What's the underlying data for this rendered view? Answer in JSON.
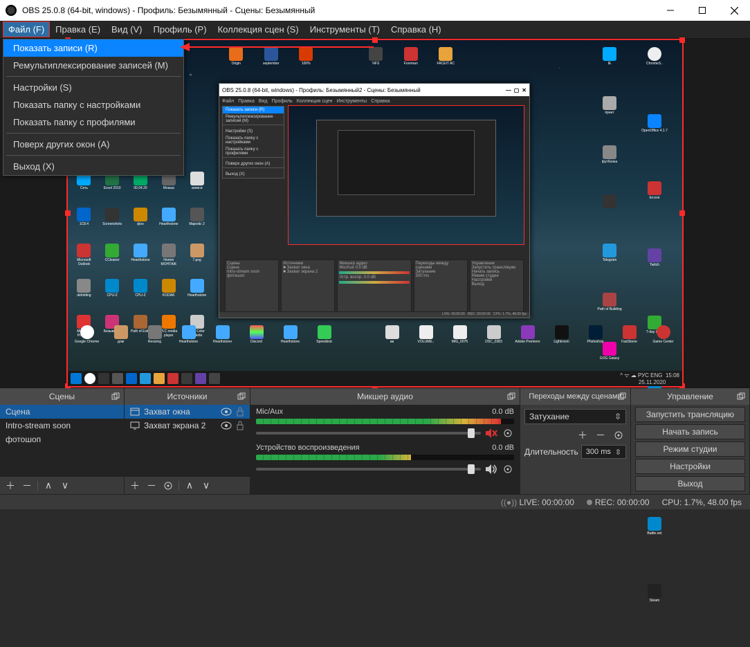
{
  "window": {
    "title": "OBS 25.0.8 (64-bit, windows) - Профиль: Безымянный - Сцены: Безымянный"
  },
  "menubar": {
    "items": [
      "Файл (F)",
      "Правка (E)",
      "Вид (V)",
      "Профиль (P)",
      "Коллекция сцен (S)",
      "Инструменты (T)",
      "Справка (H)"
    ]
  },
  "dropdown": {
    "items": [
      {
        "label": "Показать записи (R)",
        "hl": true
      },
      {
        "label": "Ремультиплексирование записей (M)"
      },
      {
        "sep": true
      },
      {
        "label": "Настройки (S)"
      },
      {
        "label": "Показать папку с настройками"
      },
      {
        "label": "Показать папку с профилями"
      },
      {
        "sep": true
      },
      {
        "label": "Поверх других окон (A)"
      },
      {
        "sep": true
      },
      {
        "label": "Выход (X)"
      }
    ]
  },
  "nested_title": "OBS 25.0.8 (64-bit, windows) - Профиль: Безымянный2 - Сцены: Безымянный",
  "docks": {
    "scenes": {
      "title": "Сцены",
      "items": [
        "Сцена",
        "Intro-stream soon",
        "фотошоп"
      ]
    },
    "sources": {
      "title": "Источники",
      "items": [
        {
          "icon": "window",
          "label": "Захват окна"
        },
        {
          "icon": "display",
          "label": "Захват экрана 2"
        }
      ]
    },
    "mixer": {
      "title": "Микшер аудио",
      "channels": [
        {
          "name": "Mic/Aux",
          "db": "0.0 dB",
          "muted": true,
          "fill": 95,
          "color": "#2aa84a"
        },
        {
          "name": "Устройство воспроизведения",
          "db": "0.0 dB",
          "muted": false,
          "fill": 60,
          "color": "#2aa84a"
        }
      ]
    },
    "transitions": {
      "title": "Переходы между сценами",
      "current": "Затухание",
      "duration_label": "Длительность",
      "duration": "300 ms"
    },
    "controls": {
      "title": "Управление",
      "buttons": [
        "Запустить трансляцию",
        "Начать запись",
        "Режим студии",
        "Настройки",
        "Выход"
      ]
    }
  },
  "status": {
    "live": "LIVE: 00:00:00",
    "rec": "REC: 00:00:00",
    "cpu": "CPU: 1.7%, 48.00 fps"
  }
}
